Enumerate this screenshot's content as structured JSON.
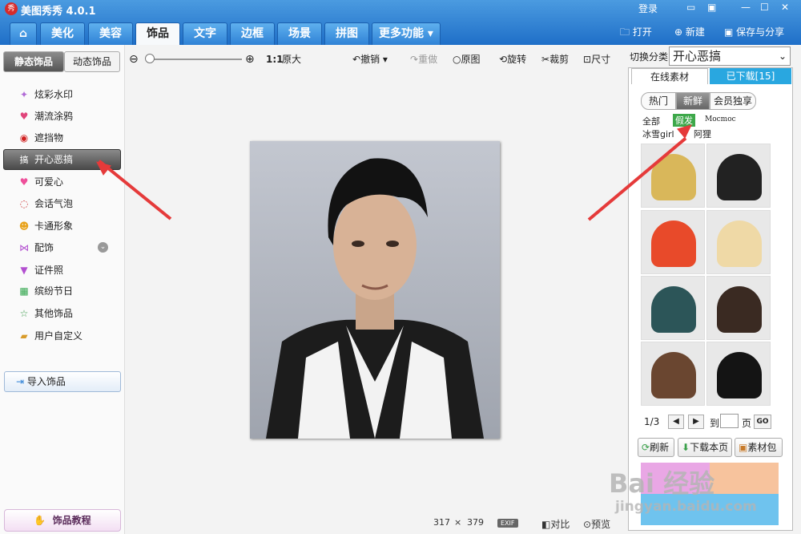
{
  "app": {
    "title": "美图秀秀 4.0.1",
    "logo_text": "秀"
  },
  "window_controls": {
    "login": "登录",
    "icons": [
      "chat-icon",
      "menu-icon",
      "minimize-icon",
      "maximize-icon",
      "close-icon"
    ]
  },
  "nav_tabs": [
    {
      "label": "美化"
    },
    {
      "label": "美容"
    },
    {
      "label": "饰品"
    },
    {
      "label": "文字"
    },
    {
      "label": "边框"
    },
    {
      "label": "场景"
    },
    {
      "label": "拼图"
    },
    {
      "label": "更多功能"
    }
  ],
  "top_actions": {
    "open": "打开",
    "new": "新建",
    "save_share": "保存与分享"
  },
  "left": {
    "subtabs": [
      "静态饰品",
      "动态饰品"
    ],
    "items": [
      {
        "label": "炫彩水印",
        "icon": "sparkle-icon"
      },
      {
        "label": "潮流涂鸦",
        "icon": "lips-icon"
      },
      {
        "label": "遮挡物",
        "icon": "mask-icon"
      },
      {
        "label": "开心恶搞",
        "icon": "prank-icon"
      },
      {
        "label": "可爱心",
        "icon": "heart-icon"
      },
      {
        "label": "会话气泡",
        "icon": "bubble-icon"
      },
      {
        "label": "卡通形象",
        "icon": "cartoon-icon"
      },
      {
        "label": "配饰",
        "icon": "bow-icon"
      },
      {
        "label": "证件照",
        "icon": "shirt-icon"
      },
      {
        "label": "缤纷节日",
        "icon": "gift-icon"
      },
      {
        "label": "其他饰品",
        "icon": "star-icon"
      },
      {
        "label": "用户自定义",
        "icon": "folder-icon"
      }
    ],
    "active_badge": "搞",
    "import": "导入饰品",
    "tutorial": "饰品教程"
  },
  "toolbar": {
    "ratio": "1:1",
    "original_size": "原大",
    "undo": "撤销",
    "redo": "重做",
    "original": "原图",
    "rotate": "旋转",
    "crop": "裁剪",
    "resize": "尺寸"
  },
  "right": {
    "switch_label": "切换分类",
    "category": "开心恶搞",
    "tabs": [
      "在线素材",
      "已下载[15]"
    ],
    "chips": [
      "热门",
      "新鲜",
      "会员独享"
    ],
    "filters": [
      "全部",
      "假发",
      "Mocmoc",
      "冰雪girl",
      "阿狸"
    ],
    "thumbs": [
      {
        "name": "blonde-short-wig",
        "color": "#d9b75a"
      },
      {
        "name": "black-bob-wig",
        "color": "#222"
      },
      {
        "name": "rainbow-afro-wig",
        "color": "#e84a2a"
      },
      {
        "name": "blonde-curly-wig",
        "color": "#efd9a6"
      },
      {
        "name": "teal-spiky-wig",
        "color": "#2c5558"
      },
      {
        "name": "brown-long-wig",
        "color": "#3a2a22"
      },
      {
        "name": "brown-bob-wig",
        "color": "#6a4630"
      },
      {
        "name": "black-messy-wig",
        "color": "#141414"
      }
    ],
    "pager": {
      "page": "1/3",
      "goto": "到",
      "page_unit": "页",
      "go": "GO"
    },
    "actions": [
      "刷新",
      "下载本页",
      "素材包"
    ]
  },
  "status": {
    "width": "317",
    "x": "×",
    "height": "379",
    "exif": "EXIF",
    "compare": "对比",
    "preview": "预览"
  },
  "watermark": {
    "main": "Bai 经验",
    "sub": "jingyan.baidu.com"
  },
  "colors": {
    "accent": "#2f82d6",
    "arrow": "#e53a3a"
  }
}
